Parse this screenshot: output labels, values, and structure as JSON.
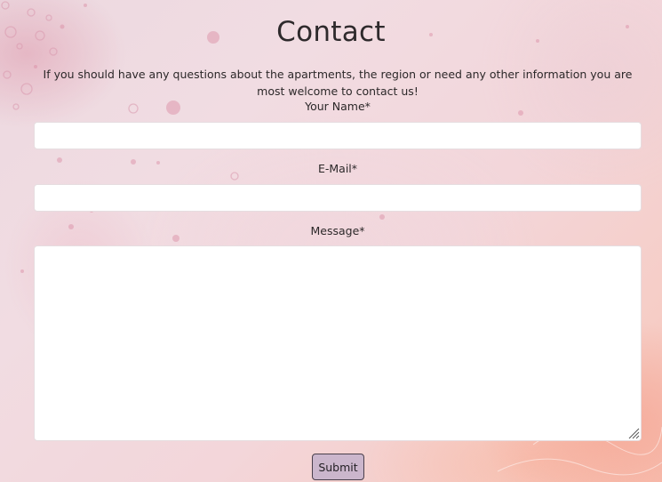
{
  "page": {
    "title": "Contact",
    "intro": "If you should have any questions about the apartments, the region or need any other information you are most welcome to contact us!"
  },
  "form": {
    "name_label": "Your Name*",
    "name_value": "",
    "email_label": "E-Mail*",
    "email_value": "",
    "message_label": "Message*",
    "message_value": "",
    "submit_label": "Submit"
  },
  "colors": {
    "submit_bg": "#cbb6cc",
    "submit_border": "#4a3f4b",
    "background_top": "#ecd9e0",
    "background_corner": "#f7bfb2"
  }
}
